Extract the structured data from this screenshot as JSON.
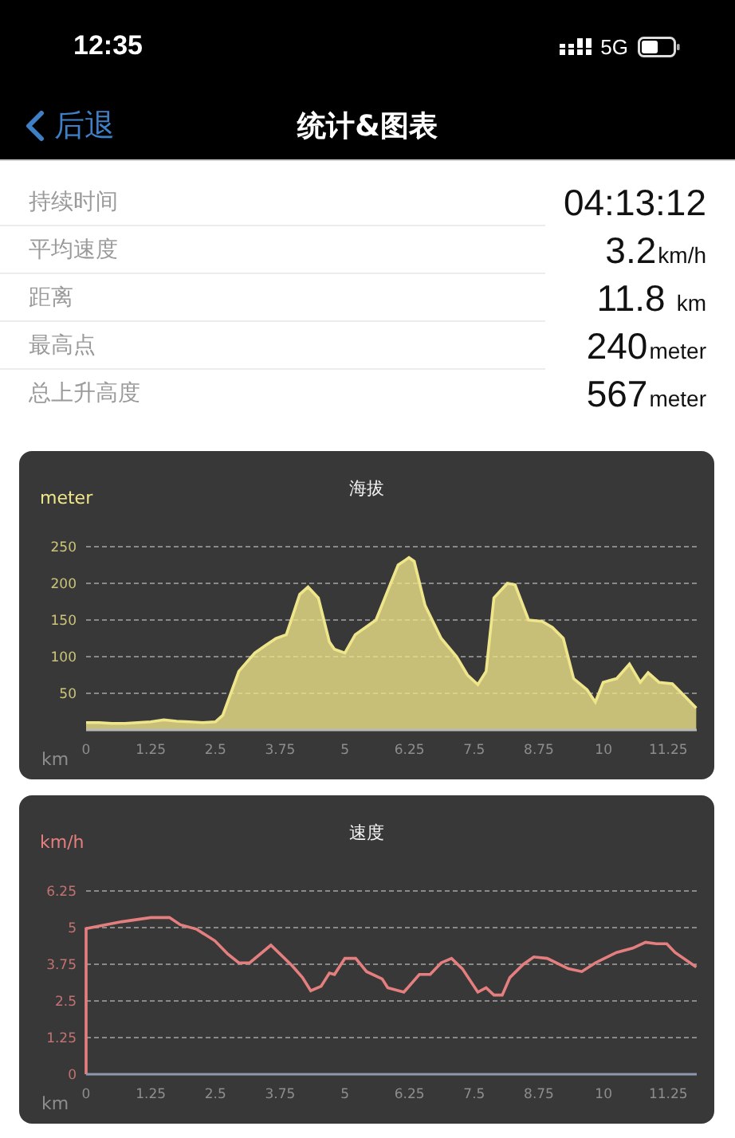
{
  "status_bar": {
    "time": "12:35",
    "network": "5G"
  },
  "nav": {
    "back": "后退",
    "title": "统计&图表"
  },
  "stats": [
    {
      "label": "持续时间",
      "value": "04:13:12"
    },
    {
      "label": "平均速度",
      "value": "3.2",
      "unit": "km/h"
    },
    {
      "label": "距离",
      "value": "11.8",
      "unit": "km"
    },
    {
      "label": "最高点",
      "value": "240",
      "unit": "meter"
    },
    {
      "label": "总上升高度",
      "value": "567",
      "unit": "meter"
    }
  ],
  "charts": [
    {
      "y_unit": "meter",
      "x_unit": "km",
      "chart_data": {
        "type": "area",
        "title": "海拔",
        "xlim": [
          0,
          11.8
        ],
        "ylim": [
          0,
          250
        ],
        "grid": true,
        "xticks": [
          0,
          1.25,
          2.5,
          3.75,
          5,
          6.25,
          7.5,
          8.75,
          10,
          11.25
        ],
        "yticks": [
          50,
          100,
          150,
          200,
          250
        ],
        "x": [
          0,
          0.25,
          0.5,
          0.75,
          1,
          1.25,
          1.5,
          1.75,
          2,
          2.25,
          2.5,
          2.64,
          2.95,
          3.26,
          3.46,
          3.67,
          3.87,
          4.13,
          4.29,
          4.49,
          4.7,
          4.8,
          5,
          5.2,
          5.4,
          5.6,
          5.83,
          6.03,
          6.24,
          6.34,
          6.55,
          6.86,
          7.16,
          7.37,
          7.57,
          7.73,
          7.88,
          8.14,
          8.29,
          8.55,
          8.81,
          9.01,
          9.22,
          9.42,
          9.68,
          9.84,
          9.99,
          10.25,
          10.5,
          10.71,
          10.86,
          11.07,
          11.33,
          11.58,
          11.79
        ],
        "series": [
          {
            "color": "#efe58a",
            "values": [
              10,
              10,
              9,
              9,
              10,
              11,
              14,
              12,
              11,
              10,
              11,
              20,
              80,
              105,
              115,
              125,
              130,
              185,
              195,
              180,
              120,
              110,
              105,
              130,
              140,
              150,
              190,
              225,
              235,
              230,
              170,
              125,
              100,
              75,
              62,
              80,
              180,
              200,
              198,
              150,
              148,
              140,
              125,
              70,
              55,
              38,
              65,
              70,
              90,
              65,
              78,
              65,
              63,
              45,
              30
            ]
          }
        ]
      }
    },
    {
      "y_unit": "km/h",
      "x_unit": "km",
      "chart_data": {
        "type": "line",
        "title": "速度",
        "xlim": [
          0,
          11.8
        ],
        "ylim": [
          0,
          6.25
        ],
        "grid": true,
        "xticks": [
          0,
          1.25,
          2.5,
          3.75,
          5,
          6.25,
          7.5,
          8.75,
          10,
          11.25
        ],
        "yticks": [
          0,
          1.25,
          2.5,
          3.75,
          5,
          6.25
        ],
        "x": [
          0,
          0,
          0.69,
          1.25,
          1.61,
          1.82,
          2.13,
          2.49,
          2.74,
          2.95,
          3.16,
          3.57,
          3.98,
          4.18,
          4.34,
          4.54,
          4.7,
          4.8,
          5,
          5.21,
          5.42,
          5.72,
          5.83,
          6.14,
          6.44,
          6.65,
          6.86,
          7.06,
          7.27,
          7.57,
          7.73,
          7.88,
          8.04,
          8.19,
          8.45,
          8.65,
          8.91,
          9.32,
          9.58,
          9.84,
          10.25,
          10.56,
          10.81,
          11.02,
          11.22,
          11.38,
          11.79
        ],
        "series": [
          {
            "color": "#e57f7f",
            "values": [
              0,
              4.97,
              5.2,
              5.34,
              5.35,
              5.1,
              4.95,
              4.55,
              4.1,
              3.8,
              3.8,
              4.4,
              3.7,
              3.3,
              2.85,
              3,
              3.45,
              3.4,
              3.95,
              3.95,
              3.5,
              3.25,
              2.95,
              2.8,
              3.4,
              3.4,
              3.8,
              3.95,
              3.6,
              2.8,
              2.95,
              2.7,
              2.7,
              3.3,
              3.75,
              4,
              3.95,
              3.6,
              3.5,
              3.8,
              4.15,
              4.3,
              4.5,
              4.45,
              4.45,
              4.15,
              3.65
            ]
          }
        ]
      }
    }
  ]
}
